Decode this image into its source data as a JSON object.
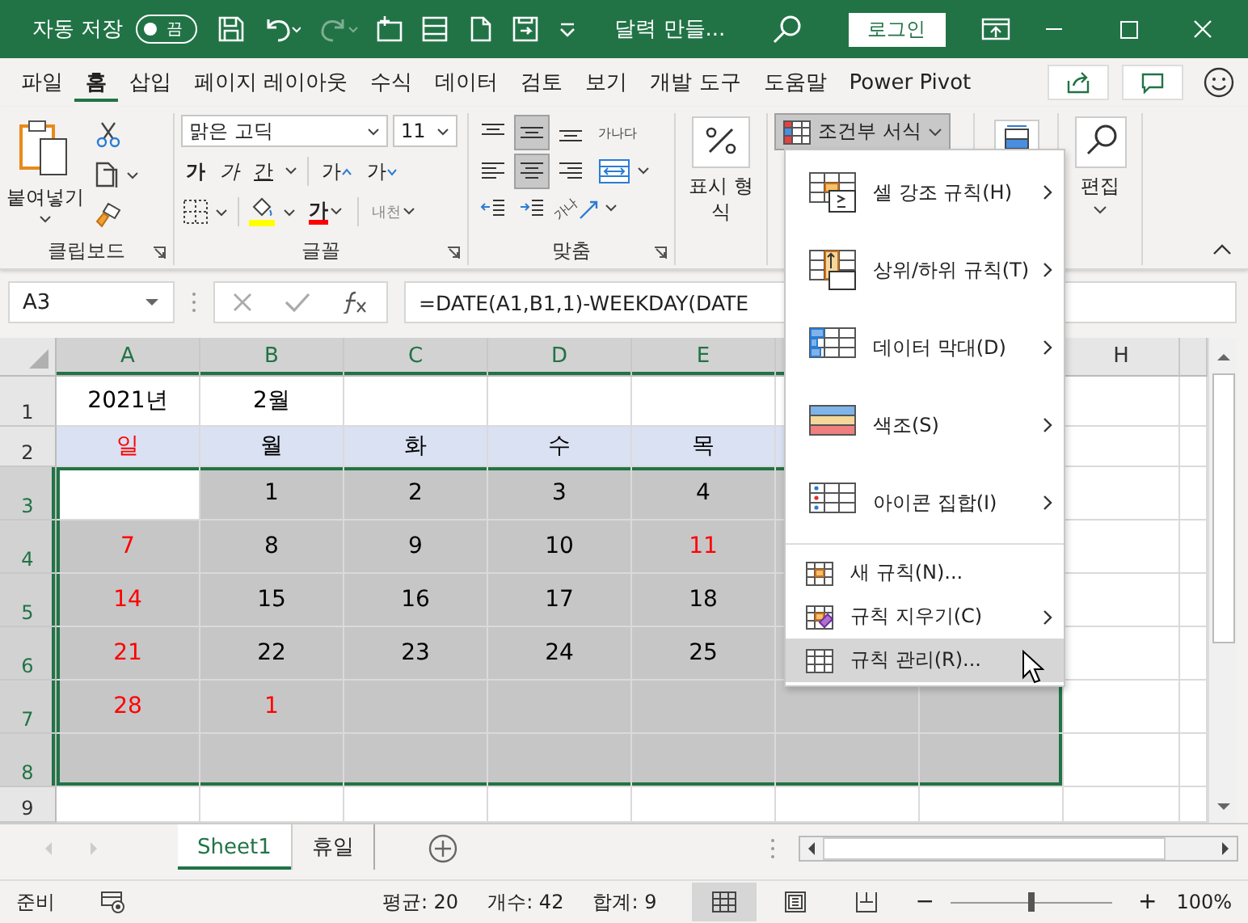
{
  "title_bar": {
    "autosave_label": "자동 저장",
    "autosave_on": false,
    "autosave_state": "끔",
    "title": "달력 만들...",
    "login": "로그인"
  },
  "ribbon_tabs": [
    {
      "label": "파일",
      "selected": false
    },
    {
      "label": "홈",
      "selected": true
    },
    {
      "label": "삽입",
      "selected": false
    },
    {
      "label": "페이지 레이아웃",
      "selected": false
    },
    {
      "label": "수식",
      "selected": false
    },
    {
      "label": "데이터",
      "selected": false
    },
    {
      "label": "검토",
      "selected": false
    },
    {
      "label": "보기",
      "selected": false
    },
    {
      "label": "개발 도구",
      "selected": false
    },
    {
      "label": "도움말",
      "selected": false
    },
    {
      "label": "Power Pivot",
      "selected": false
    }
  ],
  "ribbon": {
    "clipboard": {
      "paste": "붙여넣기",
      "label": "클립보드"
    },
    "font": {
      "name": "맑은 고딕",
      "size": "11",
      "bold": "가",
      "italic": "가",
      "underline": "간",
      "grow": "가",
      "shrink": "가",
      "color_letter": "가",
      "phonetic": "내천",
      "label": "글꼴"
    },
    "alignment": {
      "buttons": [
        {
          "selected": false
        },
        {
          "selected": true
        },
        {
          "selected": false
        },
        {
          "selected": false
        },
        {
          "selected": true
        },
        {
          "selected": false
        },
        {
          "selected": false
        },
        {
          "selected": false
        }
      ],
      "wrap": "가나다",
      "orientation": "가나",
      "label": "맞춤"
    },
    "number": {
      "label": "표시 형식"
    },
    "conditional": {
      "label": "조건부 서식",
      "expanded": true
    },
    "editing": {
      "label": "편집"
    }
  },
  "formula_bar": {
    "name_box": "A3",
    "formula": "=DATE(A1,B1,1)-WEEKDAY(DATE"
  },
  "columns": [
    "A",
    "B",
    "C",
    "D",
    "E",
    "H"
  ],
  "rows": [
    {
      "header": "1",
      "kind": "plain",
      "cells": [
        {
          "text": "2021년",
          "selected": false
        },
        {
          "text": "2월",
          "selected": false
        },
        {
          "selected": false
        },
        {
          "selected": false
        },
        {
          "selected": false
        },
        {
          "selected": false
        },
        {},
        {
          "selected": false
        }
      ]
    },
    {
      "header": "2",
      "kind": "weekdays",
      "cells": [
        {
          "text": "일",
          "color": "#ff0000",
          "selected": false
        },
        {
          "text": "월",
          "selected": false
        },
        {
          "text": "화",
          "selected": false
        },
        {
          "text": "수",
          "selected": false
        },
        {
          "text": "목",
          "selected": false
        },
        {
          "selected": false
        },
        {},
        {
          "selected": false
        }
      ]
    },
    {
      "header": "3",
      "kind": "plain",
      "cells": [
        {
          "selected": true,
          "active": true
        },
        {
          "text": "1",
          "selected": true
        },
        {
          "text": "2",
          "selected": true
        },
        {
          "text": "3",
          "selected": true
        },
        {
          "text": "4",
          "selected": true
        },
        {
          "selected": true
        },
        {},
        {
          "selected": false
        }
      ]
    },
    {
      "header": "4",
      "kind": "plain",
      "cells": [
        {
          "text": "7",
          "color": "#ff0000",
          "selected": true
        },
        {
          "text": "8",
          "selected": true
        },
        {
          "text": "9",
          "selected": true
        },
        {
          "text": "10",
          "selected": true
        },
        {
          "text": "11",
          "color": "#ff0000",
          "selected": true
        },
        {
          "selected": true
        },
        {},
        {
          "selected": false
        }
      ]
    },
    {
      "header": "5",
      "kind": "plain",
      "cells": [
        {
          "text": "14",
          "color": "#ff0000",
          "selected": true
        },
        {
          "text": "15",
          "selected": true
        },
        {
          "text": "16",
          "selected": true
        },
        {
          "text": "17",
          "selected": true
        },
        {
          "text": "18",
          "selected": true
        },
        {
          "selected": true
        },
        {},
        {
          "selected": false
        }
      ]
    },
    {
      "header": "6",
      "kind": "plain",
      "cells": [
        {
          "text": "21",
          "color": "#ff0000",
          "selected": true
        },
        {
          "text": "22",
          "selected": true
        },
        {
          "text": "23",
          "selected": true
        },
        {
          "text": "24",
          "selected": true
        },
        {
          "text": "25",
          "selected": true
        },
        {
          "selected": true
        },
        {},
        {
          "selected": false
        }
      ]
    },
    {
      "header": "7",
      "kind": "plain",
      "cells": [
        {
          "text": "28",
          "color": "#ff0000",
          "selected": true
        },
        {
          "text": "1",
          "color": "#ff0000",
          "selected": true
        },
        {
          "selected": true
        },
        {
          "selected": true
        },
        {
          "selected": true
        },
        {
          "selected": true
        },
        {
          "selected": true
        },
        {
          "selected": false
        }
      ]
    },
    {
      "header": "8",
      "kind": "plain",
      "cells": [
        {
          "selected": true
        },
        {
          "selected": true
        },
        {
          "selected": true
        },
        {
          "selected": true
        },
        {
          "selected": true
        },
        {
          "selected": true
        },
        {
          "selected": true
        },
        {
          "selected": false
        }
      ]
    },
    {
      "header": "9",
      "kind": "plain",
      "cells": [
        {
          "selected": false
        },
        {
          "selected": false
        },
        {
          "selected": false
        },
        {
          "selected": false
        },
        {
          "selected": false
        },
        {
          "selected": false
        },
        {
          "selected": false
        },
        {
          "selected": false
        }
      ]
    }
  ],
  "menu": {
    "items": [
      {
        "label": "셀 강조 규칙(H)",
        "kind": "large",
        "submenu": true,
        "selected": false
      },
      {
        "label": "상위/하위 규칙(T)",
        "kind": "large",
        "submenu": true,
        "selected": false
      },
      {
        "label": "데이터 막대(D)",
        "kind": "large",
        "submenu": true,
        "selected": false
      },
      {
        "label": "색조(S)",
        "kind": "large",
        "submenu": true,
        "selected": false
      },
      {
        "label": "아이콘 집합(I)",
        "kind": "large",
        "submenu": true,
        "selected": false
      },
      {
        "label": "새 규칙(N)...",
        "kind": "small",
        "submenu": false,
        "selected": false
      },
      {
        "label": "규칙 지우기(C)",
        "kind": "small",
        "submenu": true,
        "selected": false
      },
      {
        "label": "규칙 관리(R)...",
        "kind": "small",
        "submenu": false,
        "selected": true
      }
    ]
  },
  "sheet_tabs": [
    {
      "label": "Sheet1",
      "selected": true
    },
    {
      "label": "휴일",
      "selected": false
    }
  ],
  "status_bar": {
    "mode": "준비",
    "average": "평균: 20",
    "count": "개수: 42",
    "sum": "합계: 9",
    "views": [
      {
        "selected": true
      },
      {
        "selected": false
      },
      {
        "selected": false
      }
    ],
    "zoom": {
      "minus": "−",
      "plus": "+",
      "level": 0.5,
      "percent": "100%"
    }
  }
}
